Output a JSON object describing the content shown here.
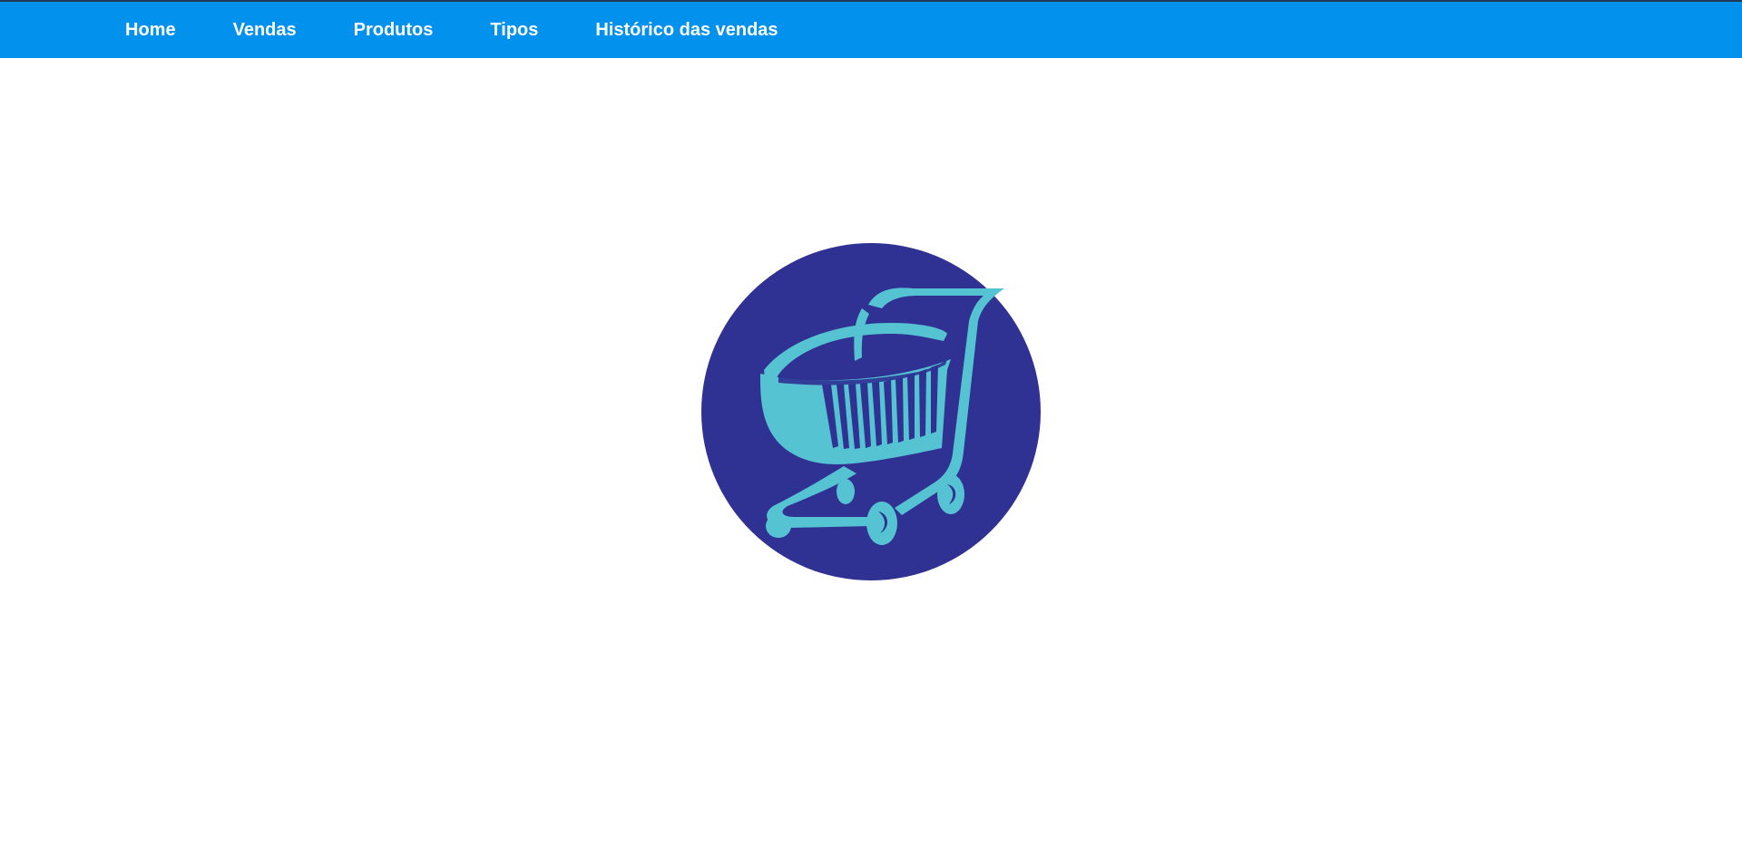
{
  "nav": {
    "items": [
      {
        "label": "Home"
      },
      {
        "label": "Vendas"
      },
      {
        "label": "Produtos"
      },
      {
        "label": "Tipos"
      },
      {
        "label": "Histórico das vendas"
      }
    ]
  },
  "logo": {
    "icon": "shopping-cart-icon",
    "circle_color": "#2f3193",
    "cart_color": "#55c3d2"
  },
  "colors": {
    "navbar": "#0292ee",
    "nav_text": "#ffffff",
    "background": "#ffffff"
  }
}
